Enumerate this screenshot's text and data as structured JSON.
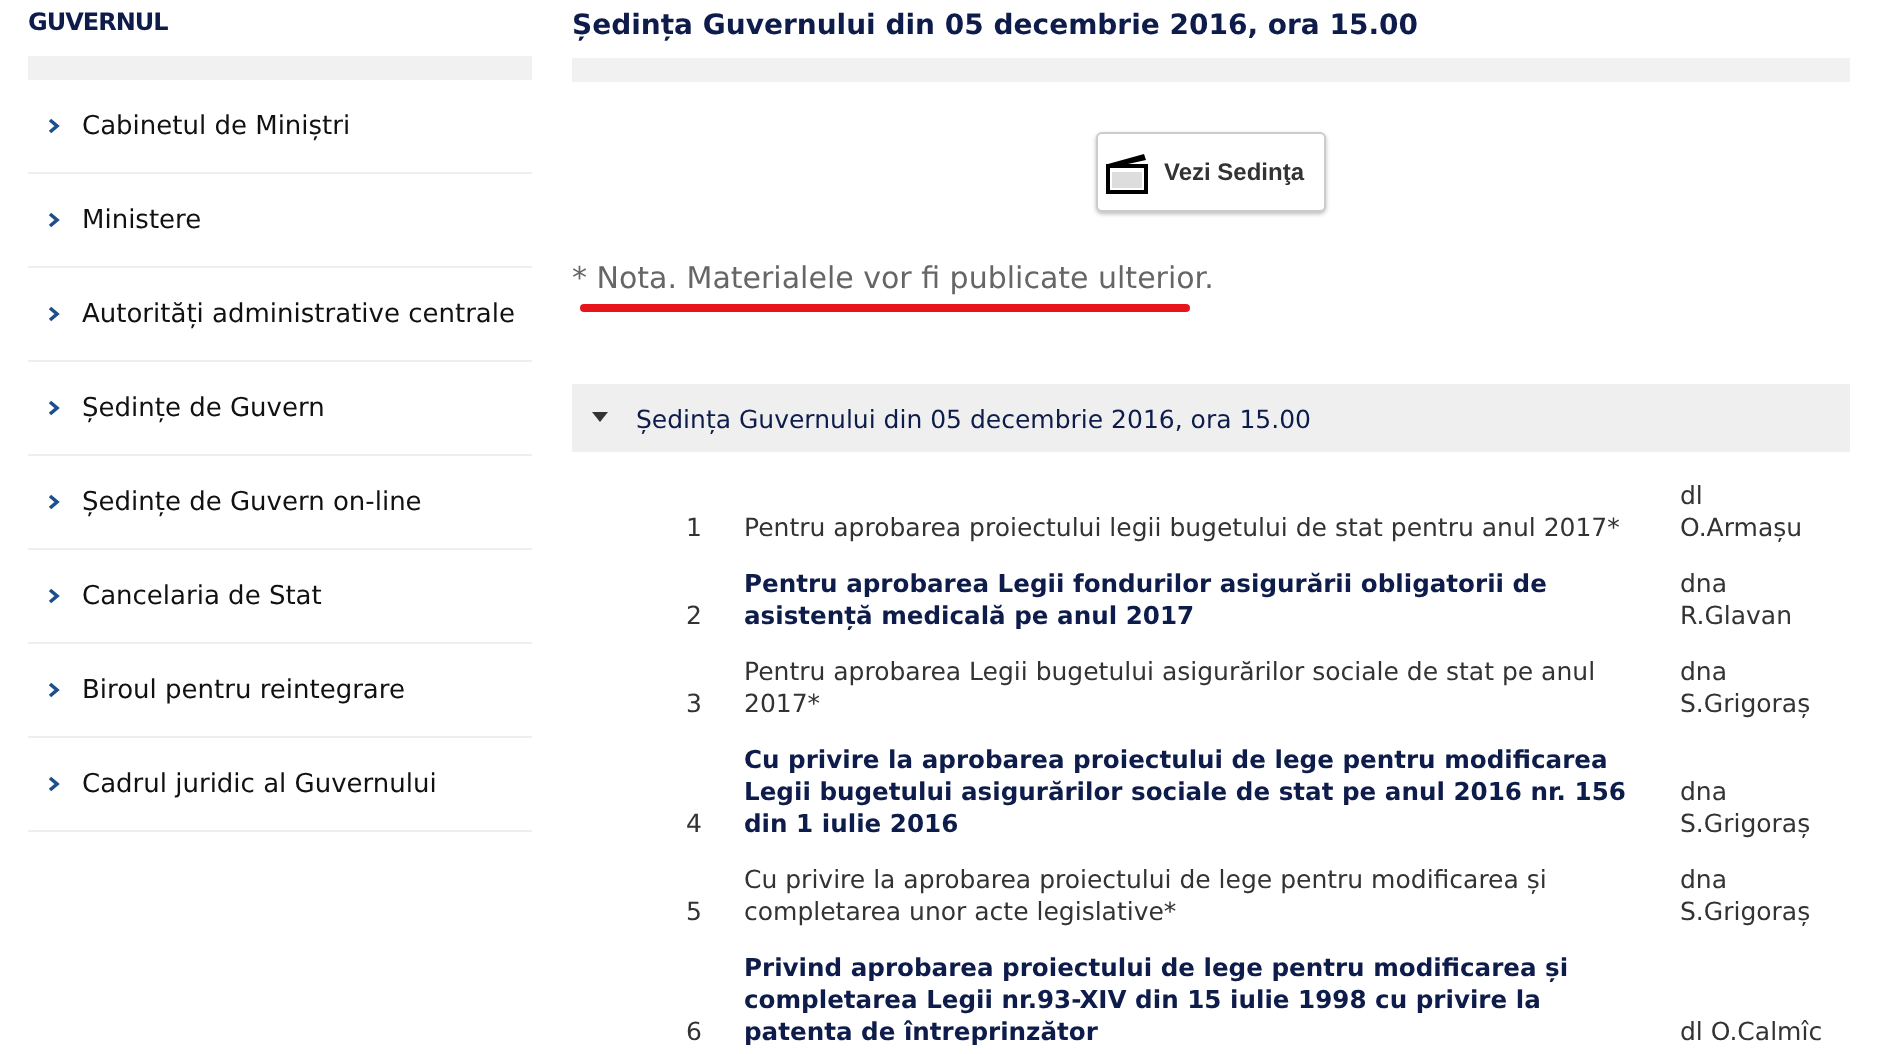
{
  "sidebar": {
    "title": "GUVERNUL",
    "items": [
      {
        "label": "Cabinetul de Miniștri"
      },
      {
        "label": "Ministere"
      },
      {
        "label": "Autorități administrative centrale"
      },
      {
        "label": "Ședințe de Guvern"
      },
      {
        "label": "Ședințe de Guvern on-line"
      },
      {
        "label": "Cancelaria de Stat"
      },
      {
        "label": "Biroul pentru reintegrare"
      },
      {
        "label": "Cadrul juridic al Guvernului"
      }
    ]
  },
  "main": {
    "title": "Ședința Guvernului din 05 decembrie 2016, ora 15.00",
    "video_button": "Vezi Sedinţa",
    "note": "* Nota. Materialele vor fi publicate ulterior.",
    "section": {
      "title": "Ședința Guvernului din 05 decembrie 2016, ora 15.00",
      "expanded": true,
      "rows": [
        {
          "number": "1",
          "text": "Pentru aprobarea proiectului legii bugetului de stat pentru anul 2017*",
          "bold": false,
          "speaker": "dl O.Armașu"
        },
        {
          "number": "2",
          "text": "Pentru aprobarea Legii fondurilor asigurării obligatorii de asistență medicală pe anul 2017",
          "bold": true,
          "speaker": "dna R.Glavan"
        },
        {
          "number": "3",
          "text": "Pentru aprobarea Legii bugetului asigurărilor sociale de stat pe anul 2017*",
          "bold": false,
          "speaker": "dna S.Grigoraș"
        },
        {
          "number": "4",
          "text": "Cu privire la aprobarea proiectului de lege pentru modificarea Legii bugetului asigurărilor sociale de stat pe anul 2016 nr. 156 din 1 iulie 2016",
          "bold": true,
          "speaker": "dna S.Grigoraș"
        },
        {
          "number": "5",
          "text": "Cu privire la aprobarea proiectului de lege pentru modificarea și completarea unor acte legislative*",
          "bold": false,
          "speaker": "dna S.Grigoraș"
        },
        {
          "number": "6",
          "text": "Privind aprobarea proiectului de lege pentru modificarea și completarea Legii nr.93-XIV din 15 iulie 1998 cu privire la patenta de întreprinzător",
          "bold": true,
          "speaker": "dl O.Calmîc"
        }
      ]
    }
  }
}
